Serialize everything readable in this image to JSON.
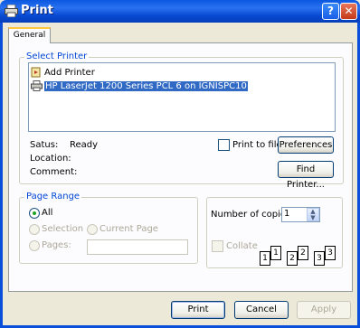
{
  "window": {
    "title": "Print"
  },
  "tabs": [
    {
      "label": "General"
    }
  ],
  "select_printer": {
    "label": "Select Printer",
    "printers": [
      {
        "name": "Add Printer",
        "icon": "add-printer-icon",
        "selected": false
      },
      {
        "name": "HP LaserJet 1200 Series PCL 6 on IGNISPC10",
        "icon": "printer-icon",
        "selected": true
      }
    ],
    "status_label": "Satus:",
    "status_value": "Ready",
    "location_label": "Location:",
    "location_value": "",
    "comment_label": "Comment:",
    "comment_value": "",
    "print_to_file_label": "Print to file",
    "print_to_file_checked": false,
    "preferences_label": "Preferences",
    "find_printer_label": "Find Printer..."
  },
  "page_range": {
    "label": "Page Range",
    "all_label": "All",
    "selection_label": "Selection",
    "current_page_label": "Current Page",
    "pages_label": "Pages:",
    "pages_value": "",
    "selected": "all"
  },
  "copies": {
    "label": "Number of copies:",
    "value": "1",
    "collate_label": "Collate",
    "collate_checked": false,
    "collate_pages": [
      "1",
      "1",
      "2",
      "2",
      "3",
      "3"
    ]
  },
  "buttons": {
    "print": "Print",
    "cancel": "Cancel",
    "apply": "Apply"
  },
  "colors": {
    "titlebar": "#0a58e0",
    "group_label": "#0046d5",
    "selection": "#316ac5",
    "face": "#ece9d8"
  }
}
